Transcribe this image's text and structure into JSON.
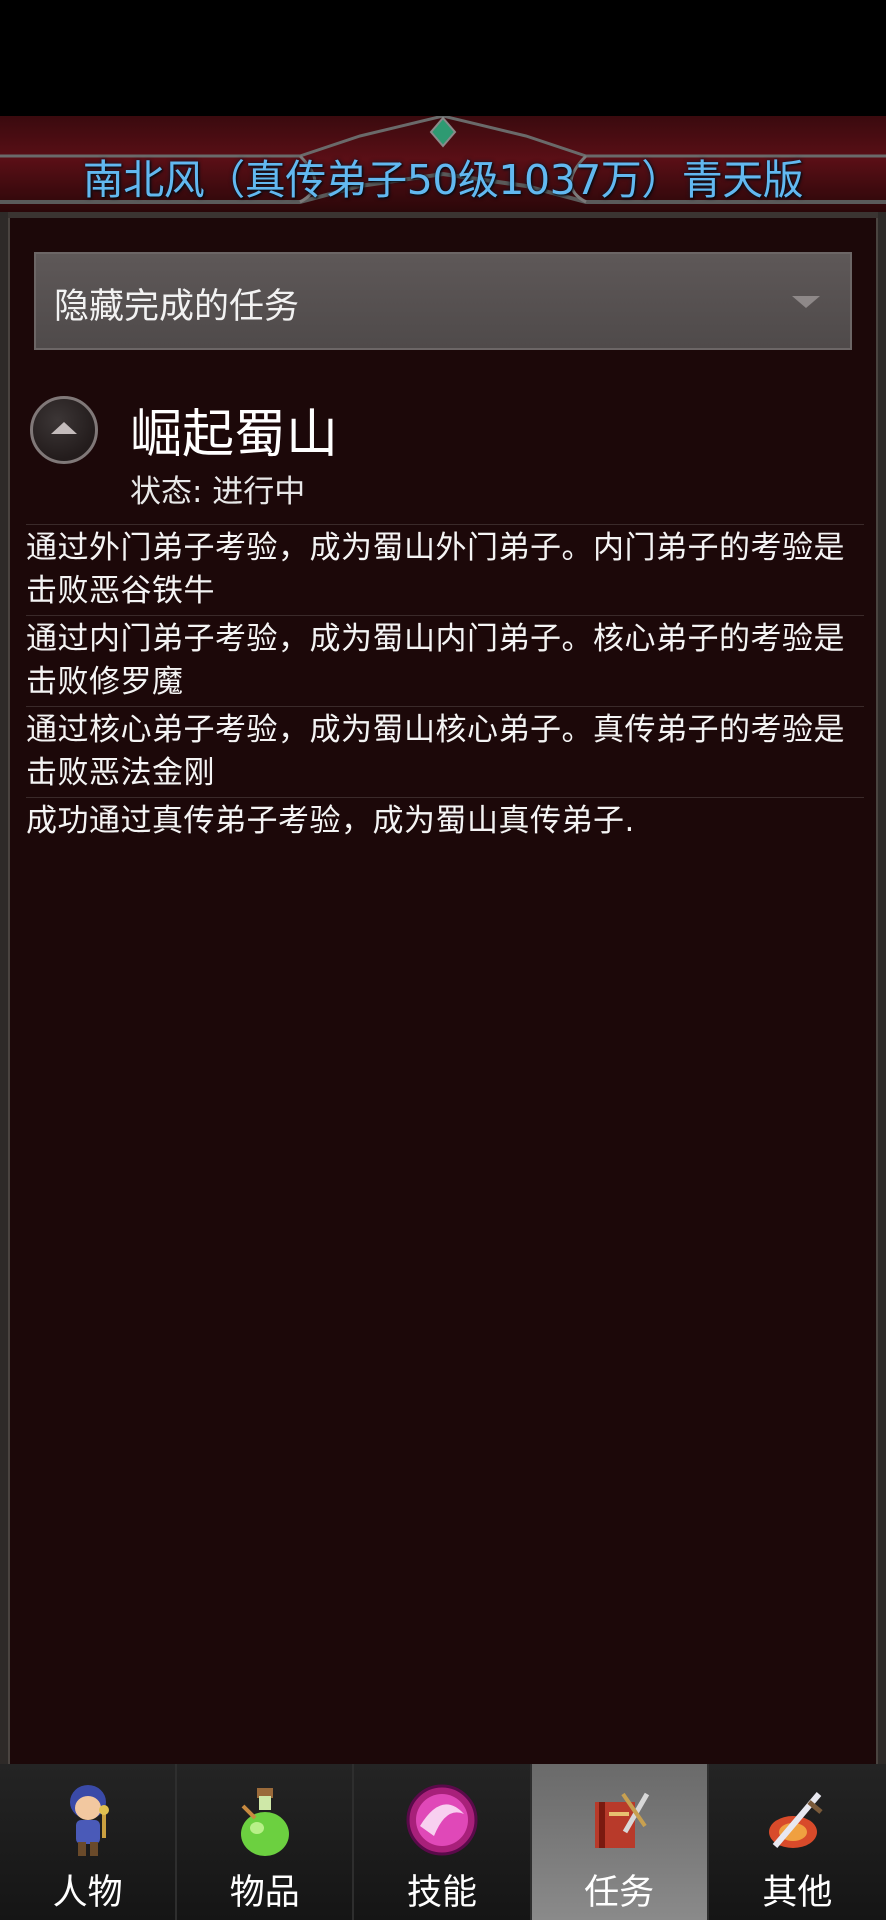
{
  "header": {
    "title": "南北风（真传弟子50级1037万）青天版"
  },
  "filter": {
    "selected": "隐藏完成的任务"
  },
  "quest": {
    "title": "崛起蜀山",
    "status": "状态: 进行中",
    "steps": [
      "通过外门弟子考验，成为蜀山外门弟子。内门弟子的考验是击败恶谷铁牛",
      "通过内门弟子考验，成为蜀山内门弟子。核心弟子的考验是击败修罗魔",
      "通过核心弟子考验，成为蜀山核心弟子。真传弟子的考验是击败恶法金刚",
      "成功通过真传弟子考验，成为蜀山真传弟子."
    ]
  },
  "tabs": [
    {
      "label": "人物",
      "icon": "character-icon",
      "active": false
    },
    {
      "label": "物品",
      "icon": "potion-icon",
      "active": false
    },
    {
      "label": "技能",
      "icon": "skill-orb-icon",
      "active": false
    },
    {
      "label": "任务",
      "icon": "quest-book-icon",
      "active": true
    },
    {
      "label": "其他",
      "icon": "sword-shield-icon",
      "active": false
    }
  ]
}
